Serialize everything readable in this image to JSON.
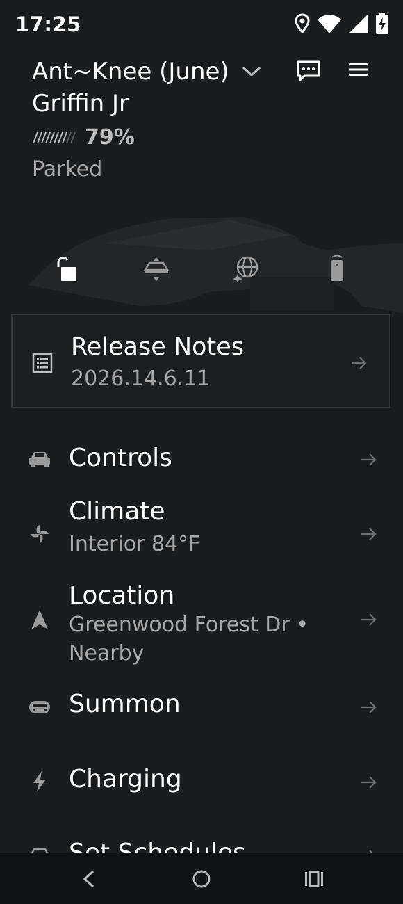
{
  "status_bar": {
    "time": "17:25",
    "icons": [
      "location-icon",
      "wifi-icon",
      "signal-icon",
      "battery-charging-icon"
    ]
  },
  "header": {
    "vehicle_name": "Ant~Knee (June) Griffin Jr",
    "battery_percent": "79%",
    "state": "Parked",
    "icons": [
      "chevron-down-icon",
      "message-icon",
      "menu-icon"
    ]
  },
  "quick_actions": [
    "unlock-icon",
    "climate-car-icon",
    "horn-globe-icon",
    "remote-icon"
  ],
  "release_notes": {
    "title": "Release Notes",
    "version": "2026.14.6.11"
  },
  "menu": {
    "controls": {
      "title": "Controls"
    },
    "climate": {
      "title": "Climate",
      "subtitle": "Interior 84°F"
    },
    "location": {
      "title": "Location",
      "subtitle": "Greenwood Forest Dr • Nearby"
    },
    "summon": {
      "title": "Summon"
    },
    "charging": {
      "title": "Charging"
    },
    "schedules": {
      "title": "Set Schedules"
    }
  },
  "colors": {
    "background": "#1b1c1e",
    "text_primary": "#ffffff",
    "text_secondary": "#a8a8a8",
    "icon_gray": "#8a8a8a",
    "nav_bar": "#101113"
  }
}
